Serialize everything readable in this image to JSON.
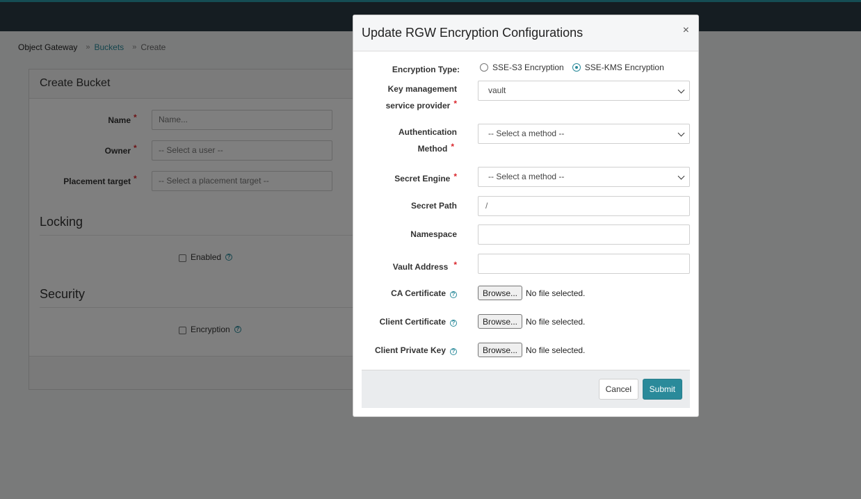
{
  "breadcrumb": {
    "root": "Object Gateway",
    "link": "Buckets",
    "current": "Create",
    "separator": "»"
  },
  "card": {
    "title": "Create Bucket",
    "fields": [
      {
        "label": "Name",
        "placeholder": "Name..."
      },
      {
        "label": "Owner",
        "placeholder": "-- Select a user --"
      },
      {
        "label": "Placement target",
        "placeholder": "-- Select a placement target --"
      }
    ],
    "locking": {
      "title": "Locking",
      "checkbox_label": "Enabled"
    },
    "security": {
      "title": "Security",
      "checkbox_label": "Encryption"
    },
    "required_mark": "*"
  },
  "modal": {
    "title": "Update RGW Encryption Configurations",
    "close": "×",
    "encryption_type": {
      "label": "Encryption Type:",
      "options": [
        "SSE-S3 Encryption",
        "SSE-KMS Encryption"
      ],
      "selected": "SSE-KMS Encryption"
    },
    "kms_provider": {
      "label_line1": "Key management",
      "label_line2": "service provider",
      "value": "vault"
    },
    "auth_method": {
      "label_line1": "Authentication",
      "label_line2": "Method",
      "value": "-- Select a method --"
    },
    "secret_engine": {
      "label": "Secret Engine",
      "value": "-- Select a method --"
    },
    "secret_path": {
      "label": "Secret Path",
      "placeholder": "/"
    },
    "namespace": {
      "label": "Namespace",
      "value": ""
    },
    "vault_address": {
      "label": "Vault Address",
      "value": ""
    },
    "ca_certificate": {
      "label": "CA Certificate",
      "button": "Browse...",
      "status": "No file selected."
    },
    "client_certificate": {
      "label": "Client Certificate",
      "button": "Browse...",
      "status": "No file selected."
    },
    "client_private_key": {
      "label": "Client Private Key",
      "button": "Browse...",
      "status": "No file selected."
    },
    "required_mark": "*",
    "help_glyph": "?",
    "cancel_label": "Cancel",
    "submit_label": "Submit"
  },
  "colors": {
    "accent": "#2a8a9a",
    "topbar": "#2b3b45",
    "required": "#d9262c"
  },
  "icons": [
    "close-icon",
    "help-icon",
    "chevron-down-icon",
    "breadcrumb-separator-icon"
  ]
}
